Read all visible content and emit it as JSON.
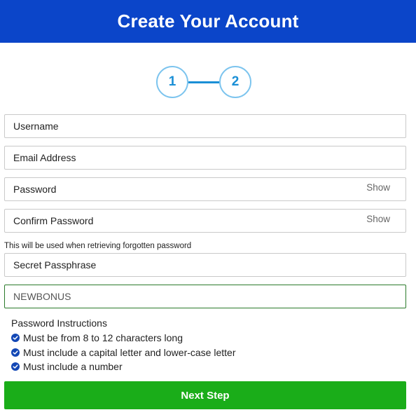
{
  "header": {
    "title": "Create Your Account"
  },
  "stepper": {
    "steps": [
      "1",
      "2"
    ]
  },
  "form": {
    "username_placeholder": "Username",
    "email_placeholder": "Email Address",
    "password_placeholder": "Password",
    "password_show": "Show",
    "confirm_placeholder": "Confirm Password",
    "confirm_show": "Show",
    "passphrase_note": "This will be used when retrieving forgotten password",
    "passphrase_placeholder": "Secret Passphrase",
    "promo_value": "NEWBONUS"
  },
  "instructions": {
    "title": "Password Instructions",
    "items": [
      "Must be from 8 to 12 characters long",
      "Must include a capital letter and lower-case letter",
      "Must include a number"
    ]
  },
  "actions": {
    "next_label": "Next Step"
  },
  "colors": {
    "header_bg": "#0b45c9",
    "step_accent": "#1a8fd6",
    "check_icon": "#1347b5",
    "next_button": "#1aad19",
    "promo_border": "#2b7a2b"
  },
  "icons": {
    "instruction_bullet": "check-circle-icon"
  }
}
